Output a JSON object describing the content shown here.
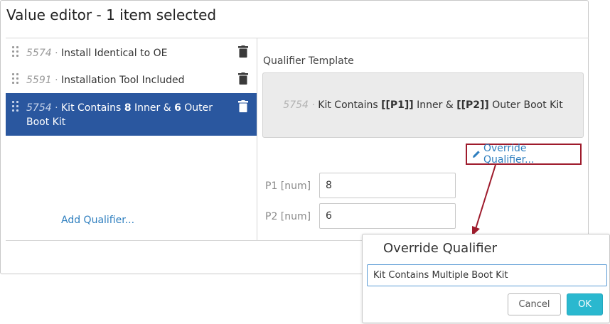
{
  "dialog": {
    "title": "Value editor - 1 item selected"
  },
  "qualifiers": [
    {
      "id": "5574",
      "sep": " · ",
      "label": "Install Identical to OE"
    },
    {
      "id": "5591",
      "sep": " · ",
      "label": "Installation Tool Included"
    },
    {
      "id": "5754",
      "sep": " · ",
      "label_parts": [
        "Kit Contains ",
        "8",
        " Inner & ",
        "6",
        " Outer Boot Kit"
      ]
    }
  ],
  "add_qualifier_label": "Add Qualifier...",
  "template": {
    "label": "Qualifier Template",
    "id": "5754",
    "sep": " · ",
    "parts": [
      "Kit Contains ",
      "[[P1]]",
      " Inner & ",
      "[[P2]]",
      " Outer Boot Kit"
    ]
  },
  "override_link_label": "Override Qualifier...",
  "params": [
    {
      "label": "P1 [num]",
      "value": "8"
    },
    {
      "label": "P2 [num]",
      "value": "6"
    }
  ],
  "popover": {
    "title": "Override Qualifier",
    "input_value": "Kit Contains Multiple Boot Kit",
    "cancel_label": "Cancel",
    "ok_label": "OK"
  },
  "colors": {
    "selected_bg": "#2a579f",
    "link": "#2f7fbf",
    "highlight_border": "#9e1b2c",
    "ok_button": "#2ab8cf"
  },
  "icons": [
    "drag-handle-icon",
    "trash-icon",
    "pencil-icon"
  ]
}
